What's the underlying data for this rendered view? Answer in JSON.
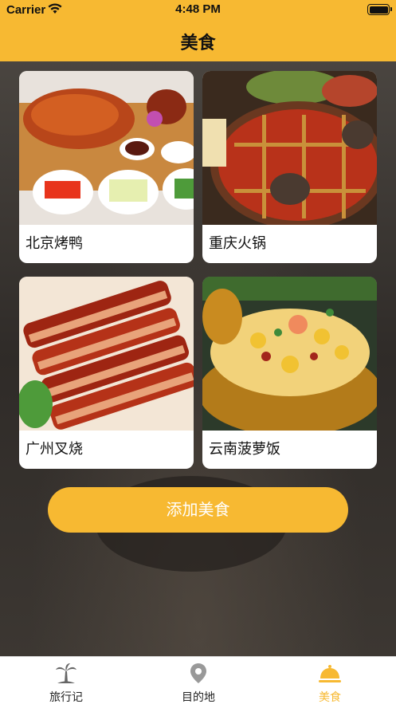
{
  "status_bar": {
    "carrier": "Carrier",
    "time": "4:48 PM"
  },
  "nav": {
    "title": "美食"
  },
  "foods": [
    {
      "name": "北京烤鸭"
    },
    {
      "name": "重庆火锅"
    },
    {
      "name": "广州叉烧"
    },
    {
      "name": "云南菠萝饭"
    }
  ],
  "add_button": {
    "label": "添加美食"
  },
  "tabs": [
    {
      "label": "旅行记",
      "icon": "palm-tree-icon"
    },
    {
      "label": "目的地",
      "icon": "map-pin-icon"
    },
    {
      "label": "美食",
      "icon": "food-cloche-icon",
      "active": true
    }
  ],
  "colors": {
    "accent": "#f7b932"
  }
}
